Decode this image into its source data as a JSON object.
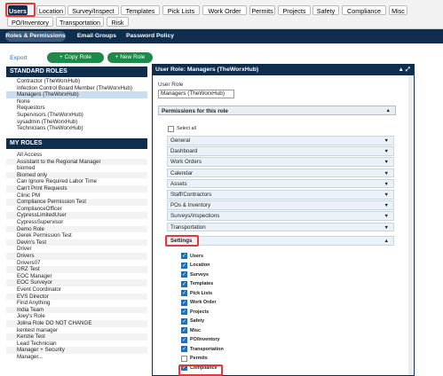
{
  "top_tabs": [
    "Users",
    "Location",
    "Survey/Inspect",
    "Templates",
    "Pick Lists",
    "Work Order",
    "Permits",
    "Projects",
    "Safety",
    "Compliance",
    "Misc",
    "PO/Inventory",
    "Transportation",
    "Risk"
  ],
  "sub_tabs": [
    "Roles & Permissions",
    "Email Groups",
    "Password Policy"
  ],
  "toolbar": {
    "export": "Export",
    "copy_role": "+ Copy Role",
    "new_role": "+ New Role"
  },
  "standard_roles": {
    "title": "STANDARD ROLES",
    "items": [
      "Contractor (TheWorxHub)",
      "Infection Control Board Member (TheWorxHub)",
      "Managers (TheWorxHub)",
      "None",
      "Requestors",
      "Supervisors (TheWorxHub)",
      "sysadmin (TheWorxHub)",
      "Technicians (TheWorxHub)"
    ]
  },
  "my_roles": {
    "title": "MY ROLES",
    "items": [
      "All Access",
      "Assistant to the Regional Manager",
      "biomed",
      "Biomed only",
      "Can Ignore Required Labor Time",
      "Can't Print Requests",
      "Clinic PM",
      "Compliance Permission Test",
      "ComplianceOfficer",
      "CypressLimitedUser",
      "CypressSupervisor",
      "Demo Role",
      "Derek Permission Test",
      "Devin's Test",
      "Driver",
      "Drivers",
      "Drivers07",
      "DRZ Test",
      "EOC Manager",
      "EOC Surveyor",
      "Event Coordinator",
      "EVS Director",
      "Find Anything",
      "India Team",
      "Joey's Role",
      "Jolina Role DO NOT CHANGE",
      "kentest manager",
      "Kenzie Test",
      "Lead Technician",
      "Manager + Security",
      "Manager..."
    ]
  },
  "panel": {
    "title": "User Role: Managers (TheWorxHub)",
    "icons": "▲ ⤢",
    "role_label": "User Role",
    "role_value": "Managers (TheWorxHub)",
    "perm_title": "Permissions for this role",
    "select_all": "Select all"
  },
  "sections": [
    "General",
    "Dashboard",
    "Work Orders",
    "Calendar",
    "Assets",
    "Staff/Contractors",
    "POs & Inventory",
    "Surveys/Inspections",
    "Transportation"
  ],
  "settings": {
    "title": "Settings",
    "items": [
      {
        "label": "Users",
        "checked": true
      },
      {
        "label": "Location",
        "checked": true
      },
      {
        "label": "Surveys",
        "checked": true
      },
      {
        "label": "Templates",
        "checked": true
      },
      {
        "label": "Pick Lists",
        "checked": true
      },
      {
        "label": "Work Order",
        "checked": true
      },
      {
        "label": "Projects",
        "checked": true
      },
      {
        "label": "Safety",
        "checked": true
      },
      {
        "label": "Misc",
        "checked": true
      },
      {
        "label": "PO/Inventory",
        "checked": true
      },
      {
        "label": "Transportation",
        "checked": true
      },
      {
        "label": "Permits",
        "checked": false
      },
      {
        "label": "Compliance",
        "checked": true
      }
    ]
  },
  "colors": {
    "navy": "#0f2e4d",
    "green": "#1e8a4a",
    "highlight": "#e03a3a",
    "selected": "#c9dff0"
  }
}
